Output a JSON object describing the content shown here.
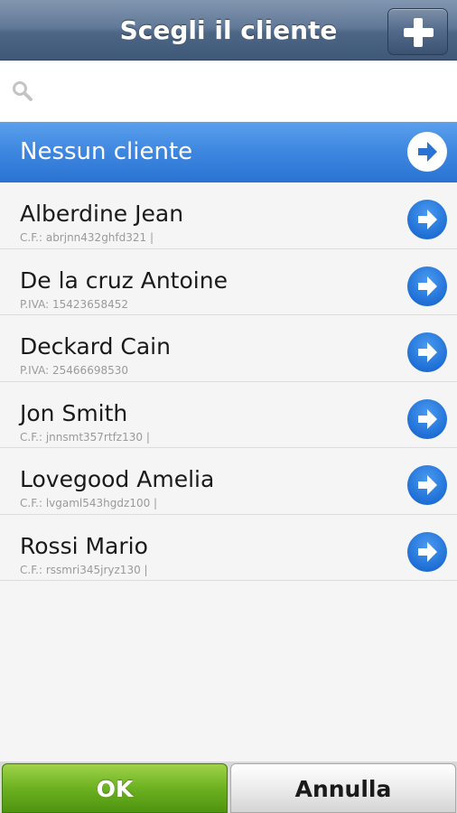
{
  "header": {
    "title": "Scegli il cliente",
    "add_icon": "plus-icon"
  },
  "search": {
    "placeholder": "",
    "value": "",
    "icon": "search-icon"
  },
  "no_client": {
    "label": "Nessun cliente",
    "icon": "arrow-right-icon"
  },
  "clients": [
    {
      "name": "Alberdine Jean",
      "detail": "C.F.: abrjnn432ghfd321 |"
    },
    {
      "name": "De la cruz Antoine",
      "detail": "P.IVA: 15423658452"
    },
    {
      "name": "Deckard Cain",
      "detail": "P.IVA: 25466698530"
    },
    {
      "name": "Jon Smith",
      "detail": "C.F.: jnnsmt357rtfz130 |"
    },
    {
      "name": "Lovegood Amelia",
      "detail": "C.F.: lvgaml543hgdz100 |"
    },
    {
      "name": "Rossi Mario",
      "detail": "C.F.: rssmri345jryz130 |"
    }
  ],
  "footer": {
    "ok_label": "OK",
    "cancel_label": "Annulla"
  },
  "colors": {
    "header": "#52698a",
    "selected_row": "#3d86e0",
    "arrow": "#1f6fd6",
    "ok_button": "#6cb120"
  }
}
